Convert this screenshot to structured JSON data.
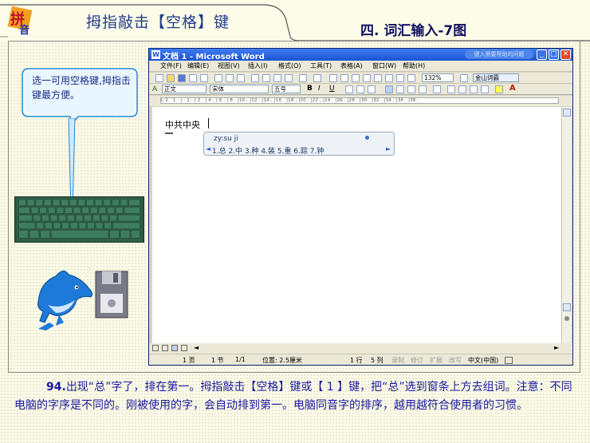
{
  "header": {
    "title": "拇指敲击【空格】键",
    "tab_label": "四. 词汇输入-7图",
    "logo_text": "拼音"
  },
  "callout": {
    "text": "选一可用空格键,拇指击键最方便。"
  },
  "word": {
    "window_title": "文档 1 - Microsoft Word",
    "help_placeholder": "键入需要帮助的问题",
    "menus": [
      "文件(F)",
      "编辑(E)",
      "视图(V)",
      "插入(I)",
      "格式(O)",
      "工具(T)",
      "表格(A)",
      "窗口(W)",
      "帮助(H)"
    ],
    "zoom": "132%",
    "dict_btn": "金山词霸",
    "style_select": "正文",
    "font_select": "宋体",
    "size_select": "五号",
    "ruler_text": "L 2 · 1 · | · 1 · | 2 · | 4 · | 6 · | 8 · |10 · |12 · |14 · |16 · |18 · |20 · |22 · |24 · |26 · |28 · |30 · |32 · |34 · |36 · |38 ·",
    "doc_text": "中共中央"
  },
  "ime": {
    "input": "zy:su ji",
    "candidates": "1.总  2.中  3.种  4.装  5.重  6.踪  7.钟"
  },
  "status": {
    "page": "1 页",
    "section": "1 节",
    "pages": "1/1",
    "pos": "位置: 2.5厘米",
    "line": "1 行",
    "col": "5 列",
    "rec": "录制",
    "trk": "修订",
    "ext": "扩展",
    "ovr": "改写",
    "lang": "中文(中国)"
  },
  "caption": {
    "num": "94.",
    "text": "出现“总”字了，排在第一。拇指敲击【空格】键或【 1 】键，把“总”选到窗条上方去组词。注意：不同电脑的字序是不同的。刚被使用的字，会自动排到第一。电脑同音字的排序，越用越符合使用者的习惯。"
  }
}
